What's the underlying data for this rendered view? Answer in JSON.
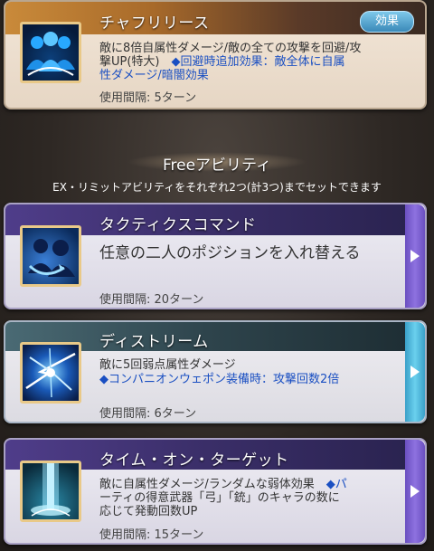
{
  "top_card": {
    "title": "チャフリリース",
    "badge": "効果",
    "desc_line1": "敵に8倍自属性ダメージ/敵の全ての攻撃を回避/攻",
    "desc_line2a": "撃UP(特大)　",
    "desc_line2b": "◆回避時追加効果：敵全体に自属",
    "desc_line3": "性ダメージ/暗闇効果",
    "interval": "使用間隔: 5ターン"
  },
  "free_section": {
    "title": "Freeアビリティ",
    "subtitle": "EX・リミットアビリティをそれぞれ2つ(計3つ)までセットできます"
  },
  "abilities": [
    {
      "title": "タクティクスコマンド",
      "desc": "任意の二人のポジションを入れ替える",
      "interval": "使用間隔: 20ターン"
    },
    {
      "title": "ディストリーム",
      "desc_line1": "敵に5回弱点属性ダメージ",
      "desc_line2": "◆コンパニオンウェポン装備時：攻撃回数2倍",
      "interval": "使用間隔: 6ターン"
    },
    {
      "title": "タイム・オン・ターゲット",
      "desc_line1a": "敵に自属性ダメージ/ランダムな弱体効果　",
      "desc_line1b": "◆パ",
      "desc_line2": "ーティの得意武器「弓」「銃」のキャラの数に",
      "desc_line3": "応じて発動回数UP",
      "interval": "使用間隔: 15ターン"
    }
  ],
  "colors": {
    "ability_tab_purple": "#7a5cc8",
    "ability_tab_cyan": "#4fb8d8",
    "desc_blue": "#1a4fc2"
  },
  "icons": [
    "team-buff-icon",
    "swap-position-icon",
    "lightning-burst-icon",
    "light-pillar-icon",
    "chevron-right-icon"
  ]
}
